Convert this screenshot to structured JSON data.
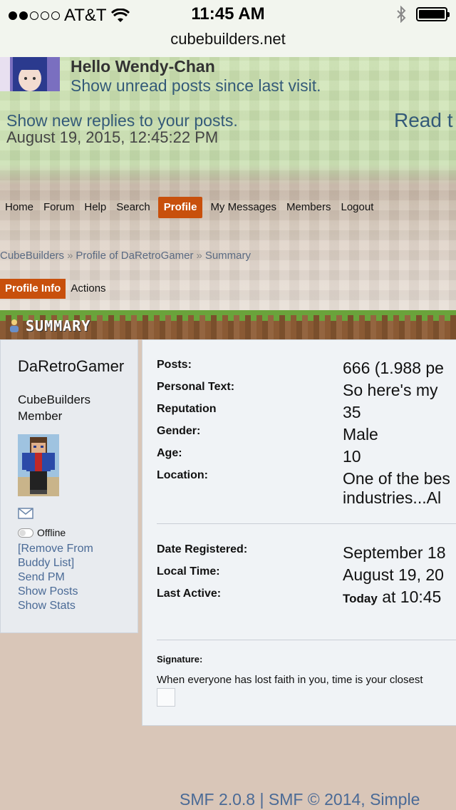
{
  "status_bar": {
    "carrier": "AT&T",
    "time": "11:45 AM",
    "signal_icon": "signal-dots-icon",
    "wifi_icon": "wifi-icon",
    "bluetooth_icon": "bluetooth-icon",
    "battery_icon": "battery-icon"
  },
  "browser": {
    "url": "cubebuilders.net"
  },
  "header": {
    "hello": "Hello Wendy-Chan",
    "unread": "Show unread posts since last visit.",
    "new_replies": "Show new replies to your posts.",
    "datetime": "August 19, 2015, 12:45:22 PM",
    "read_link": "Read t"
  },
  "nav": {
    "items": [
      {
        "label": "Home"
      },
      {
        "label": "Forum"
      },
      {
        "label": "Help"
      },
      {
        "label": "Search"
      },
      {
        "label": "Profile",
        "active": true
      },
      {
        "label": "My Messages"
      },
      {
        "label": "Members"
      },
      {
        "label": "Logout"
      }
    ]
  },
  "breadcrumb": {
    "items": [
      "CubeBuilders",
      "Profile of DaRetroGamer",
      "Summary"
    ],
    "separator": "»"
  },
  "subtabs": {
    "profile_info": "Profile Info",
    "actions": "Actions"
  },
  "summary_label": "SUMMARY",
  "profile": {
    "name": "DaRetroGamer",
    "group": "CubeBuilders Member",
    "status": "Offline",
    "links": {
      "remove_buddy": "[Remove From Buddy List]",
      "send_pm": "Send PM",
      "show_posts": "Show Posts",
      "show_stats": "Show Stats"
    }
  },
  "details": {
    "posts_label": "Posts:",
    "posts_value": "666 (1.988 pe",
    "personal_text_label": "Personal Text:",
    "personal_text_value": "So here's my",
    "reputation_label": "Reputation",
    "reputation_value": "35",
    "gender_label": "Gender:",
    "gender_value": "Male",
    "age_label": "Age:",
    "age_value": "10",
    "location_label": "Location:",
    "location_value_line1": "One of the bes",
    "location_value_line2": "industries...Al",
    "date_registered_label": "Date Registered:",
    "date_registered_value": "September 18",
    "local_time_label": "Local Time:",
    "local_time_value": "August 19, 20",
    "last_active_label": "Last Active:",
    "last_active_today": "Today",
    "last_active_value": " at 10:45",
    "signature_label": "Signature:",
    "signature_text": "When everyone has lost faith in you, time is your closest"
  },
  "footer": {
    "text": "SMF 2.0.8 | SMF © 2014, Simple"
  }
}
